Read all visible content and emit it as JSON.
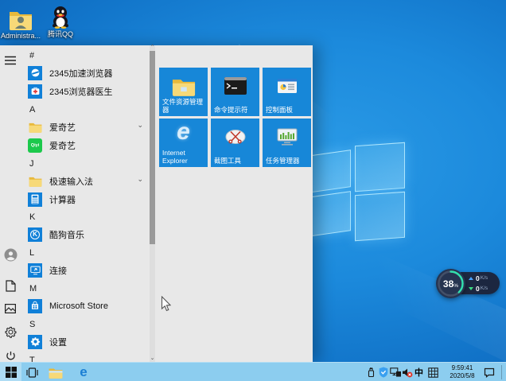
{
  "desktop": {
    "icons": [
      {
        "label": "Administra...",
        "icon": "user-folder-icon"
      },
      {
        "label": "腾讯QQ",
        "icon": "qq-icon"
      }
    ]
  },
  "start_menu": {
    "sections": [
      {
        "header": "#",
        "items": [
          {
            "label": "2345加速浏览器",
            "icon": "browser-2345-icon"
          },
          {
            "label": "2345浏览器医生",
            "icon": "doctor-2345-icon"
          }
        ]
      },
      {
        "header": "A",
        "items": [
          {
            "label": "爱奇艺",
            "icon": "folder-icon",
            "expandable": true
          },
          {
            "label": "爱奇艺",
            "icon": "iqiyi-icon"
          }
        ]
      },
      {
        "header": "J",
        "items": [
          {
            "label": "极速输入法",
            "icon": "folder-icon",
            "expandable": true
          },
          {
            "label": "计算器",
            "icon": "calculator-icon"
          }
        ]
      },
      {
        "header": "K",
        "items": [
          {
            "label": "酷狗音乐",
            "icon": "kugou-icon"
          }
        ]
      },
      {
        "header": "L",
        "items": [
          {
            "label": "连接",
            "icon": "connect-icon"
          }
        ]
      },
      {
        "header": "M",
        "items": [
          {
            "label": "Microsoft Store",
            "icon": "store-icon"
          }
        ]
      },
      {
        "header": "S",
        "items": [
          {
            "label": "设置",
            "icon": "settings-icon"
          }
        ]
      },
      {
        "header": "T",
        "items": []
      }
    ],
    "tiles": [
      {
        "label": "文件资源管理器",
        "icon": "file-explorer-icon"
      },
      {
        "label": "命令提示符",
        "icon": "command-prompt-icon"
      },
      {
        "label": "控制面板",
        "icon": "control-panel-icon"
      },
      {
        "label": "Internet Explorer",
        "icon": "internet-explorer-icon"
      },
      {
        "label": "截图工具",
        "icon": "snipping-tool-icon"
      },
      {
        "label": "任务管理器",
        "icon": "task-manager-icon"
      }
    ]
  },
  "taskbar": {
    "input_indicator": "中",
    "clock": {
      "time": "9:59:41",
      "date": "2020/5/8"
    }
  },
  "floating_widget": {
    "percent": "38",
    "percent_unit": "%",
    "upload_value": "0",
    "upload_unit": "K/s",
    "download_value": "0",
    "download_unit": "K/s"
  },
  "icons": {
    "ie_glyph": "e",
    "edge_glyph": "e",
    "kugou_glyph": "K",
    "iqiyi_glyph": "Qiyi"
  },
  "colors": {
    "tile_blue": "#1787d8",
    "taskbar_blue": "#8ccdef",
    "menu_bg": "#e8e8e8",
    "widget_arc": "#32e0ae",
    "upload_arrow": "#4aa3ff",
    "download_arrow": "#3ddc84"
  }
}
